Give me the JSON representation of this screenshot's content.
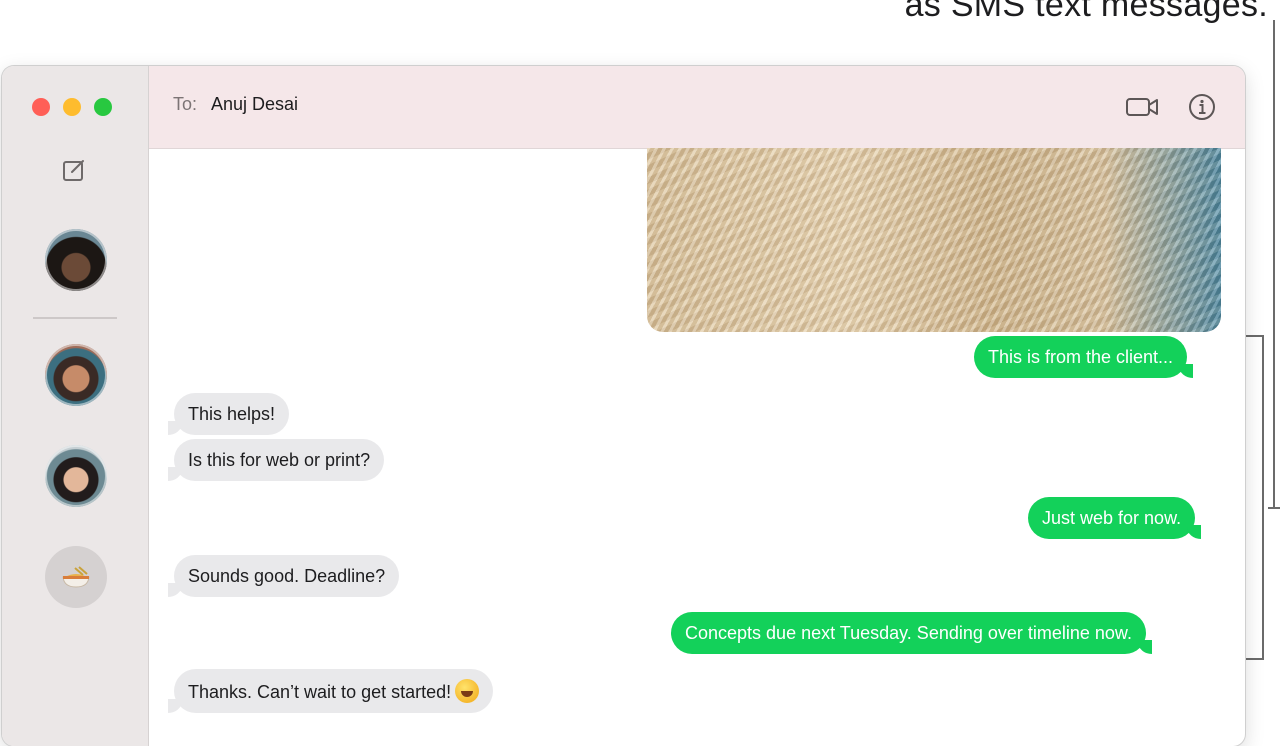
{
  "callout": {
    "text": "as SMS text messages."
  },
  "header": {
    "to_label": "To:",
    "recipient": "Anuj Desai"
  },
  "sidebar": {
    "conversations": [
      {
        "icon": "contact-avatar"
      },
      {
        "icon": "contact-avatar"
      },
      {
        "icon": "contact-avatar"
      },
      {
        "icon": "noodle-bowl-icon"
      }
    ]
  },
  "messages": [
    {
      "direction": "sent",
      "text": "This is from the client..."
    },
    {
      "direction": "received",
      "text": "This helps!"
    },
    {
      "direction": "received",
      "text": "Is this for web or print?"
    },
    {
      "direction": "sent",
      "text": "Just web for now."
    },
    {
      "direction": "received",
      "text": "Sounds good. Deadline?"
    },
    {
      "direction": "sent",
      "text": "Concepts due next Tuesday. Sending over timeline now."
    },
    {
      "direction": "received",
      "text": "Thanks. Can’t wait to get started!",
      "emoji": "grinning-face-emoji"
    }
  ],
  "colors": {
    "sent_bubble": "#13d15a",
    "received_bubble": "#e9e9eb",
    "header_bg": "#f5e7e9",
    "sidebar_bg": "#ebe7e7"
  }
}
